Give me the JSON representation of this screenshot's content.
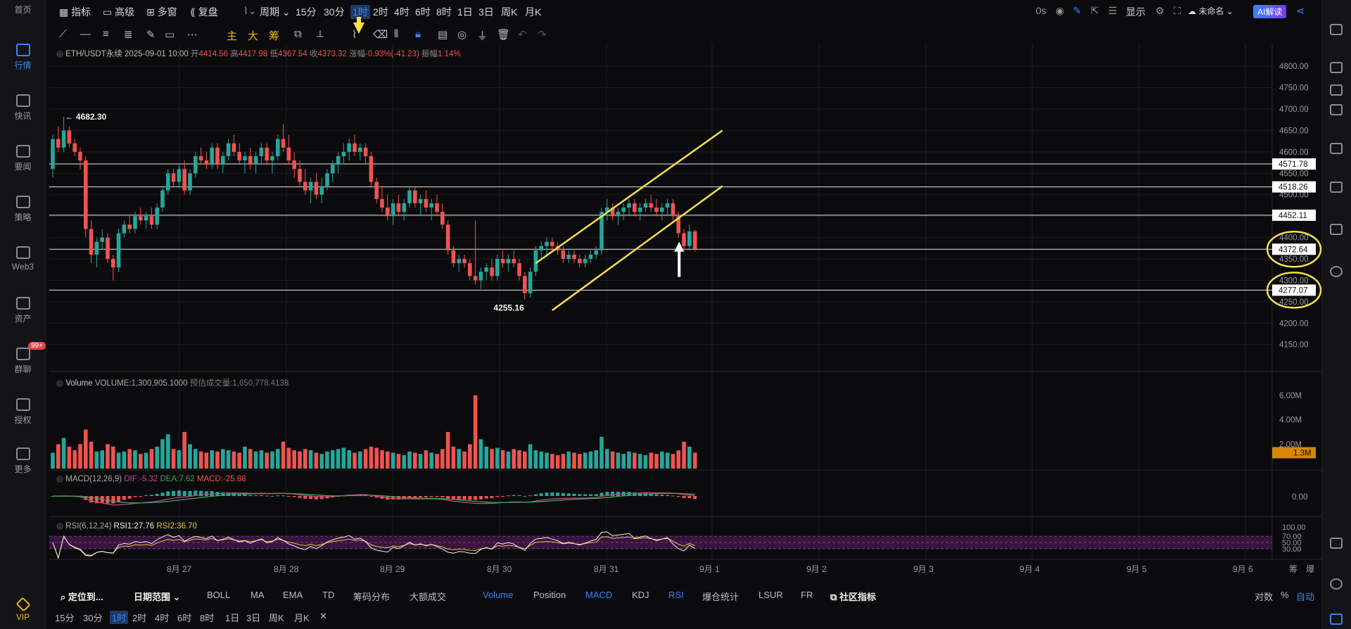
{
  "nav": {
    "items": [
      {
        "label": "首页",
        "icon": "home-icon"
      },
      {
        "label": "行情",
        "icon": "chart-icon",
        "active": true
      },
      {
        "label": "快讯",
        "icon": "flash-news-icon"
      },
      {
        "label": "要闻",
        "icon": "news-icon"
      },
      {
        "label": "策略",
        "icon": "strategy-icon"
      },
      {
        "label": "Web3",
        "icon": "web3-icon"
      },
      {
        "label": "资产",
        "icon": "wallet-icon"
      },
      {
        "label": "群聊",
        "icon": "chat-icon",
        "badge": "99+"
      },
      {
        "label": "授权",
        "icon": "key-icon"
      },
      {
        "label": "更多",
        "icon": "more-grid-icon"
      }
    ],
    "vip": "VIP"
  },
  "topbar": {
    "indicators": "指标",
    "advanced": "高级",
    "multi": "多窗",
    "replay": "复盘",
    "period": "周期",
    "intervals": [
      "15分",
      "30分",
      "1时",
      "2时",
      "4时",
      "6时",
      "8时",
      "1日",
      "3日",
      "周K",
      "月K"
    ],
    "active_interval": "1时",
    "countdown": "0s",
    "display": "显示",
    "layout_name": "未命名",
    "ai": "AI解读"
  },
  "drawtools": {
    "main": "主",
    "big": "大",
    "chip": "筹"
  },
  "legend": {
    "symbol": "ETH/USDT永续",
    "time": "2025-09-01 10:00",
    "open_label": "开",
    "open": "4414.56",
    "high_label": "高",
    "high": "4417.98",
    "low_label": "低",
    "low": "4367.54",
    "close_label": "收",
    "close": "4373.32",
    "change_label": "涨幅",
    "change": "-0.93%(-41.23)",
    "amp_label": "振幅",
    "amp": "1.14%"
  },
  "price_axis": {
    "ticks": [
      "4800.00",
      "4750.00",
      "4700.00",
      "4650.00",
      "4600.00",
      "4550.00",
      "4500.00",
      "4450.00",
      "4400.00",
      "4350.00",
      "4300.00",
      "4250.00",
      "4200.00",
      "4150.00"
    ],
    "levels": [
      "4571.78",
      "4518.26",
      "4452.11",
      "4372.64",
      "4277.07"
    ]
  },
  "annotations": {
    "high": "← 4682.30",
    "low": "4255.16"
  },
  "volume": {
    "label": "Volume",
    "value_text": "VOLUME:1,300,905.1000",
    "est_text": "预估成交量:1,650,778.4138",
    "ticks": [
      "6.00M",
      "4.00M",
      "2.00M"
    ],
    "current": "1.3M"
  },
  "macd": {
    "label": "MACD(12,26,9)",
    "dif": "DIF:-5.32",
    "dea": "DEA:7.62",
    "macd": "MACD:-25.88",
    "tick": "0.00"
  },
  "rsi": {
    "label": "RSI(6,12,24)",
    "rsi1": "RSI1:27.76",
    "rsi2": "RSI2:36.70",
    "ticks": [
      "100.00",
      "70.00",
      "50.00",
      "30.00"
    ]
  },
  "xaxis": {
    "labels": [
      "8月 27",
      "8月 28",
      "8月 29",
      "8月 30",
      "8月 31",
      "9月 1",
      "9月 2",
      "9月 3",
      "9月 4",
      "9月 5",
      "9月 6"
    ],
    "right": [
      "筹",
      "爆"
    ]
  },
  "bottom1": {
    "locate": "定位到...",
    "range": "日期范围",
    "main_inds": [
      "BOLL",
      "MA",
      "EMA",
      "TD",
      "筹码分布",
      "大额成交"
    ],
    "sub_inds": [
      "Volume",
      "Position",
      "MACD",
      "KDJ",
      "RSI",
      "爆仓统计",
      "LSUR",
      "FR"
    ],
    "active_sub": [
      "Volume",
      "MACD",
      "RSI"
    ],
    "community": "社区指标",
    "log": "对数",
    "pct": "%",
    "auto": "自动"
  },
  "bottom2": {
    "intervals": [
      "15分",
      "30分",
      "1时",
      "2时",
      "4时",
      "6时",
      "8时",
      "1日",
      "3日",
      "周K",
      "月K"
    ],
    "active": "1时",
    "close": "✕"
  },
  "colors": {
    "up": "#26a69a",
    "down": "#ef5350",
    "accent": "#3b82f6",
    "channel": "#f4e04d",
    "macd_dif": "#c0448f",
    "macd_dea": "#3fa34d",
    "rsi1": "#f0f0f0",
    "rsi2": "#e5c542",
    "rsi_band": "#3a1340"
  },
  "chart_data": {
    "type": "candlestick",
    "symbol": "ETH/USDT永续",
    "interval": "1时",
    "ylim": [
      4120,
      4820
    ],
    "candles_ohlc": [
      [
        4560,
        4640,
        4540,
        4630
      ],
      [
        4630,
        4660,
        4600,
        4610
      ],
      [
        4610,
        4682.3,
        4600,
        4650
      ],
      [
        4650,
        4660,
        4610,
        4620
      ],
      [
        4620,
        4630,
        4590,
        4600
      ],
      [
        4600,
        4610,
        4560,
        4580
      ],
      [
        4580,
        4590,
        4400,
        4420
      ],
      [
        4420,
        4440,
        4340,
        4360
      ],
      [
        4360,
        4400,
        4330,
        4390
      ],
      [
        4390,
        4420,
        4370,
        4400
      ],
      [
        4400,
        4410,
        4340,
        4350
      ],
      [
        4350,
        4360,
        4300,
        4330
      ],
      [
        4330,
        4420,
        4320,
        4410
      ],
      [
        4410,
        4440,
        4400,
        4430
      ],
      [
        4430,
        4450,
        4410,
        4420
      ],
      [
        4420,
        4460,
        4410,
        4450
      ],
      [
        4450,
        4470,
        4430,
        4440
      ],
      [
        4440,
        4460,
        4420,
        4450
      ],
      [
        4450,
        4470,
        4420,
        4430
      ],
      [
        4430,
        4480,
        4420,
        4470
      ],
      [
        4470,
        4520,
        4460,
        4510
      ],
      [
        4510,
        4560,
        4500,
        4550
      ],
      [
        4550,
        4560,
        4520,
        4530
      ],
      [
        4530,
        4570,
        4520,
        4560
      ],
      [
        4560,
        4580,
        4500,
        4510
      ],
      [
        4510,
        4560,
        4500,
        4550
      ],
      [
        4550,
        4600,
        4540,
        4590
      ],
      [
        4590,
        4610,
        4570,
        4580
      ],
      [
        4580,
        4600,
        4560,
        4570
      ],
      [
        4570,
        4620,
        4560,
        4610
      ],
      [
        4610,
        4620,
        4560,
        4570
      ],
      [
        4570,
        4600,
        4550,
        4590
      ],
      [
        4590,
        4630,
        4580,
        4620
      ],
      [
        4620,
        4640,
        4590,
        4600
      ],
      [
        4600,
        4620,
        4570,
        4580
      ],
      [
        4580,
        4600,
        4550,
        4590
      ],
      [
        4590,
        4610,
        4560,
        4570
      ],
      [
        4570,
        4600,
        4550,
        4590
      ],
      [
        4590,
        4620,
        4570,
        4610
      ],
      [
        4610,
        4620,
        4570,
        4580
      ],
      [
        4580,
        4600,
        4550,
        4590
      ],
      [
        4590,
        4640,
        4580,
        4630
      ],
      [
        4630,
        4665,
        4600,
        4610
      ],
      [
        4610,
        4640,
        4570,
        4580
      ],
      [
        4580,
        4600,
        4540,
        4560
      ],
      [
        4560,
        4580,
        4520,
        4530
      ],
      [
        4530,
        4560,
        4500,
        4510
      ],
      [
        4510,
        4540,
        4480,
        4530
      ],
      [
        4530,
        4550,
        4490,
        4500
      ],
      [
        4500,
        4540,
        4480,
        4520
      ],
      [
        4520,
        4560,
        4510,
        4550
      ],
      [
        4550,
        4580,
        4530,
        4570
      ],
      [
        4570,
        4600,
        4550,
        4590
      ],
      [
        4590,
        4620,
        4570,
        4600
      ],
      [
        4600,
        4630,
        4580,
        4620
      ],
      [
        4620,
        4640,
        4590,
        4600
      ],
      [
        4600,
        4620,
        4580,
        4610
      ],
      [
        4610,
        4620,
        4570,
        4590
      ],
      [
        4590,
        4600,
        4520,
        4530
      ],
      [
        4530,
        4540,
        4480,
        4490
      ],
      [
        4490,
        4520,
        4460,
        4470
      ],
      [
        4470,
        4500,
        4440,
        4450
      ],
      [
        4450,
        4490,
        4430,
        4480
      ],
      [
        4480,
        4500,
        4450,
        4460
      ],
      [
        4460,
        4490,
        4440,
        4480
      ],
      [
        4480,
        4520,
        4470,
        4510
      ],
      [
        4510,
        4520,
        4470,
        4480
      ],
      [
        4480,
        4500,
        4450,
        4490
      ],
      [
        4490,
        4510,
        4460,
        4470
      ],
      [
        4470,
        4490,
        4440,
        4480
      ],
      [
        4480,
        4500,
        4450,
        4460
      ],
      [
        4460,
        4480,
        4420,
        4430
      ],
      [
        4430,
        4440,
        4360,
        4370
      ],
      [
        4370,
        4380,
        4330,
        4340
      ],
      [
        4340,
        4360,
        4320,
        4350
      ],
      [
        4350,
        4360,
        4330,
        4340
      ],
      [
        4340,
        4350,
        4300,
        4310
      ],
      [
        4310,
        4440,
        4290,
        4300
      ],
      [
        4300,
        4330,
        4280,
        4320
      ],
      [
        4320,
        4340,
        4300,
        4330
      ],
      [
        4330,
        4350,
        4300,
        4310
      ],
      [
        4310,
        4360,
        4300,
        4350
      ],
      [
        4350,
        4370,
        4330,
        4340
      ],
      [
        4340,
        4360,
        4320,
        4350
      ],
      [
        4350,
        4370,
        4330,
        4340
      ],
      [
        4340,
        4350,
        4300,
        4310
      ],
      [
        4310,
        4320,
        4255.16,
        4270
      ],
      [
        4270,
        4330,
        4260,
        4320
      ],
      [
        4320,
        4380,
        4310,
        4370
      ],
      [
        4370,
        4390,
        4350,
        4380
      ],
      [
        4380,
        4400,
        4360,
        4390
      ],
      [
        4390,
        4400,
        4370,
        4380
      ],
      [
        4380,
        4390,
        4360,
        4370
      ],
      [
        4370,
        4380,
        4340,
        4350
      ],
      [
        4350,
        4370,
        4340,
        4360
      ],
      [
        4360,
        4370,
        4340,
        4350
      ],
      [
        4350,
        4360,
        4330,
        4340
      ],
      [
        4340,
        4360,
        4330,
        4350
      ],
      [
        4350,
        4370,
        4340,
        4360
      ],
      [
        4360,
        4380,
        4350,
        4370
      ],
      [
        4370,
        4470,
        4360,
        4460
      ],
      [
        4460,
        4490,
        4440,
        4470
      ],
      [
        4470,
        4480,
        4440,
        4450
      ],
      [
        4450,
        4470,
        4430,
        4460
      ],
      [
        4460,
        4480,
        4440,
        4470
      ],
      [
        4470,
        4490,
        4450,
        4480
      ],
      [
        4480,
        4490,
        4450,
        4460
      ],
      [
        4460,
        4480,
        4440,
        4470
      ],
      [
        4470,
        4490,
        4460,
        4480
      ],
      [
        4480,
        4500,
        4460,
        4470
      ],
      [
        4470,
        4490,
        4450,
        4460
      ],
      [
        4460,
        4480,
        4440,
        4470
      ],
      [
        4470,
        4490,
        4450,
        4480
      ],
      [
        4480,
        4490,
        4440,
        4450
      ],
      [
        4450,
        4460,
        4400,
        4410
      ],
      [
        4410,
        4420,
        4370,
        4380
      ],
      [
        4380,
        4430,
        4370,
        4414.56
      ],
      [
        4414.56,
        4417.98,
        4367.54,
        4373.32
      ]
    ],
    "horizontal_levels": [
      4571.78,
      4518.26,
      4452.11,
      4372.64,
      4277.07
    ],
    "channel_upper": [
      [
        88,
        4340
      ],
      [
        122,
        4650
      ]
    ],
    "channel_lower": [
      [
        91,
        4230
      ],
      [
        122,
        4520
      ]
    ],
    "volume_millions": [
      1.3,
      2.0,
      2.5,
      1.8,
      1.5,
      2.0,
      3.2,
      2.2,
      1.4,
      1.5,
      2.0,
      1.8,
      1.3,
      1.4,
      1.6,
      1.5,
      1.2,
      1.3,
      1.6,
      1.8,
      2.4,
      2.8,
      1.6,
      1.5,
      3.0,
      2.0,
      1.6,
      1.4,
      1.3,
      1.5,
      1.4,
      1.6,
      1.5,
      1.4,
      1.3,
      1.8,
      1.6,
      1.4,
      1.5,
      1.3,
      1.4,
      1.6,
      2.2,
      1.7,
      1.5,
      1.4,
      1.6,
      1.5,
      1.3,
      1.2,
      1.4,
      1.5,
      1.6,
      1.7,
      1.5,
      1.3,
      1.4,
      1.6,
      1.8,
      1.7,
      1.5,
      1.4,
      1.3,
      1.2,
      1.1,
      1.4,
      1.3,
      1.2,
      1.5,
      1.3,
      1.2,
      1.6,
      3.0,
      1.8,
      1.6,
      1.4,
      2.0,
      6.0,
      2.4,
      1.8,
      1.6,
      1.7,
      1.5,
      1.4,
      1.6,
      1.5,
      1.4,
      2.0,
      1.5,
      1.4,
      1.3,
      1.2,
      1.1,
      1.2,
      1.4,
      1.3,
      1.2,
      1.3,
      1.4,
      1.5,
      2.6,
      1.6,
      1.4,
      1.3,
      1.2,
      1.4,
      1.3,
      1.2,
      1.1,
      1.3,
      1.2,
      1.4,
      1.3,
      1.2,
      1.5,
      2.2,
      1.8,
      1.3
    ]
  }
}
